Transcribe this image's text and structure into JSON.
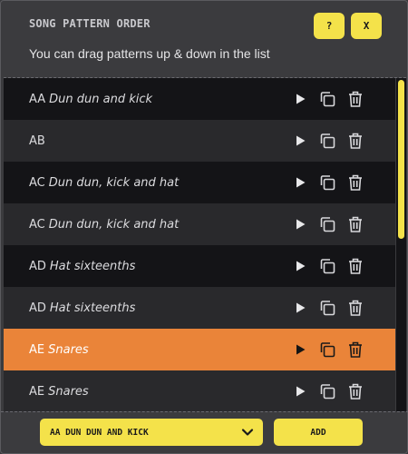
{
  "dialog": {
    "title": "SONG PATTERN ORDER",
    "subtitle": "You can drag patterns up & down in the list",
    "help_label": "?",
    "close_label": "X"
  },
  "patterns": [
    {
      "code": "AA",
      "name": "Dun dun and kick",
      "selected": false
    },
    {
      "code": "AB",
      "name": "",
      "selected": false
    },
    {
      "code": "AC",
      "name": "Dun dun, kick and hat",
      "selected": false
    },
    {
      "code": "AC",
      "name": "Dun dun, kick and hat",
      "selected": false
    },
    {
      "code": "AD",
      "name": "Hat sixteenths",
      "selected": false
    },
    {
      "code": "AD",
      "name": "Hat sixteenths",
      "selected": false
    },
    {
      "code": "AE",
      "name": "Snares",
      "selected": true
    },
    {
      "code": "AE",
      "name": "Snares",
      "selected": false
    }
  ],
  "row_icons": [
    "play-icon",
    "duplicate-icon",
    "trash-icon"
  ],
  "footer": {
    "select_value": "AA DUN DUN AND KICK",
    "add_label": "ADD"
  },
  "scroll_position": 0.0,
  "colors": {
    "accent": "#f4e24a",
    "selected_row": "#ea8439",
    "row_dark": "#141417",
    "row_light": "#29292c",
    "panel": "#3b3b3e"
  }
}
